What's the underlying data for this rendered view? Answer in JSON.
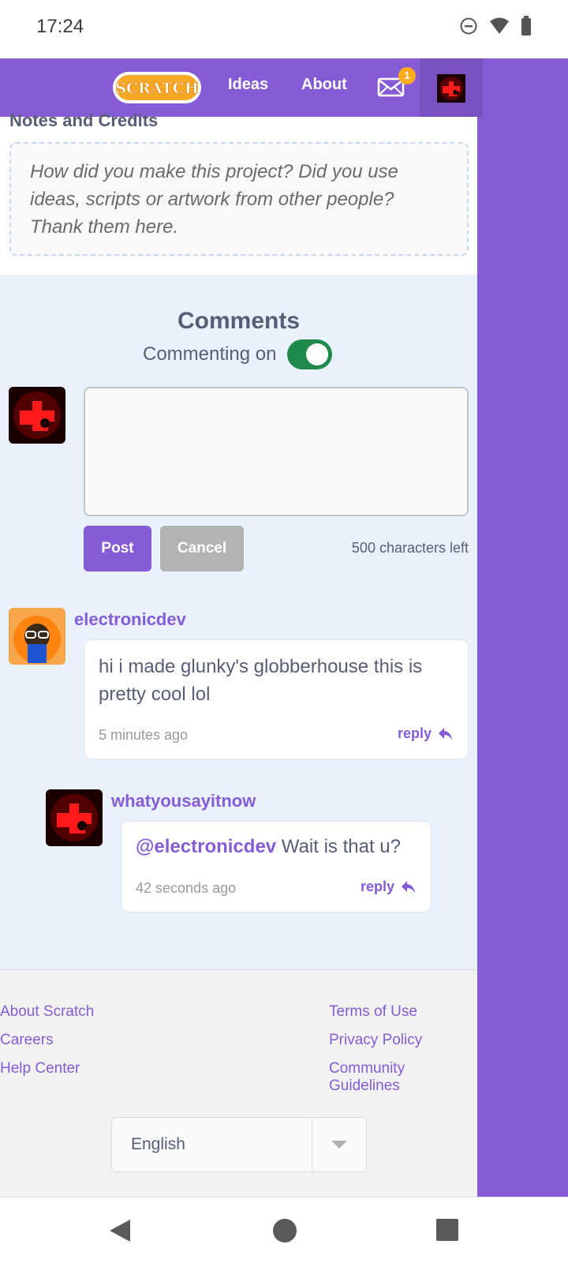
{
  "status_bar": {
    "time": "17:24"
  },
  "navbar": {
    "logo_text": "SCRATCH",
    "links": [
      "Ideas",
      "About"
    ],
    "mail_badge": "1"
  },
  "notes": {
    "title": "Notes and Credits",
    "placeholder": "How did you make this project? Did you use ideas, scripts or artwork from other people? Thank them here."
  },
  "comments": {
    "title": "Comments",
    "commenting_label": "Commenting on",
    "commenting_enabled": true,
    "post_label": "Post",
    "cancel_label": "Cancel",
    "chars_left": "500 characters left",
    "items": [
      {
        "username": "electronicdev",
        "text": "hi i made glunky's globberhouse this is pretty cool lol",
        "time": "5 minutes ago",
        "reply_label": "reply"
      },
      {
        "username": "whatyousayitnow",
        "mention": "@electronicdev",
        "text": " Wait is that u?",
        "time": "42 seconds ago",
        "reply_label": "reply"
      }
    ]
  },
  "footer": {
    "left_links": [
      "About Scratch",
      "Careers",
      "Help Center"
    ],
    "right_links": [
      "Terms of Use",
      "Privacy Policy",
      "Community Guidelines"
    ],
    "language": "English"
  },
  "colors": {
    "brand": "#855cd6",
    "toggle_on": "#1f8a4c",
    "badge": "#ffab1a"
  },
  "icons": [
    "dnd-icon",
    "wifi-icon",
    "battery-icon",
    "mail-icon",
    "reply-icon",
    "chevron-down-icon",
    "back-icon",
    "home-icon",
    "recents-icon"
  ]
}
